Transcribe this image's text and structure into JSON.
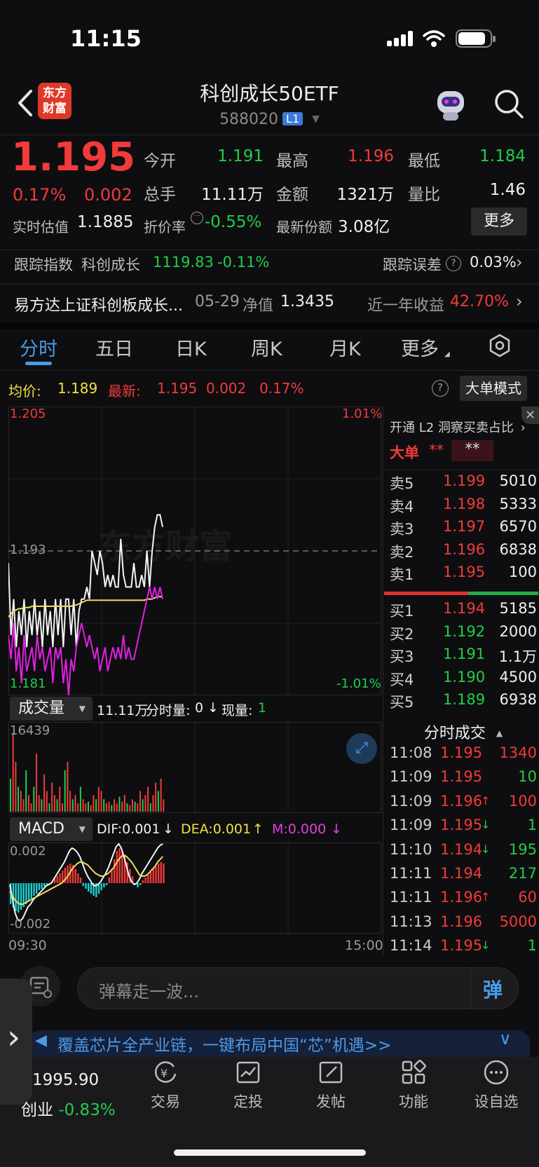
{
  "status": {
    "time": "11:15"
  },
  "header": {
    "logo": [
      "东方",
      "财富"
    ],
    "title": "科创成长50ETF",
    "code": "588020",
    "level": "L1"
  },
  "quote": {
    "price": "1.195",
    "change_pct": "0.17%",
    "change": "0.002",
    "open_label": "今开",
    "open": "1.191",
    "high_label": "最高",
    "high": "1.196",
    "low_label": "最低",
    "low": "1.184",
    "volume_label": "总手",
    "volume": "11.11万",
    "amount_label": "金额",
    "amount": "1321万",
    "ratio_label": "量比",
    "ratio": "1.46",
    "iopv_label": "实时估值",
    "iopv": "1.1885",
    "discount_label": "折价率",
    "discount": "-0.55%",
    "shares_label": "最新份额",
    "shares": "3.08亿",
    "more_button": "更多"
  },
  "tracking": {
    "index_label": "跟踪指数",
    "index_name": "科创成长",
    "index_value": "1119.83",
    "index_change": "-0.11%",
    "error_label": "跟踪误差",
    "error_value": "0.03%"
  },
  "fund": {
    "name": "易方达上证科创板成长...",
    "date": "05-29",
    "nav_label": "净值",
    "nav": "1.3435",
    "yield_label": "近一年收益",
    "yield": "42.70%"
  },
  "tabs": [
    "分时",
    "五日",
    "日K",
    "周K",
    "月K",
    "更多"
  ],
  "chart_info": {
    "avg_label": "均价:",
    "avg": "1.189",
    "latest_label": "最新:",
    "latest": "1.195",
    "change": "0.002",
    "pct": "0.17%",
    "big_order_button": "大单模式"
  },
  "chart_data": {
    "type": "line",
    "y_top": "1.205",
    "y_mid": "1.193",
    "y_bottom": "1.181",
    "pct_top": "1.01%",
    "pct_bottom": "-1.01%",
    "ylim": [
      1.181,
      1.205
    ],
    "ref": 1.193,
    "x_start": "09:30",
    "x_end": "15:00",
    "series": [
      {
        "values": [
          1.192,
          1.186,
          1.189,
          1.185,
          1.188,
          1.186,
          1.189,
          1.185,
          1.188,
          1.186,
          1.189,
          1.186,
          1.188,
          1.185,
          1.189,
          1.186,
          1.188,
          1.185,
          1.189,
          1.186,
          1.189,
          1.185,
          1.189,
          1.189,
          1.186,
          1.189,
          1.185,
          1.188,
          1.189,
          1.189,
          1.19,
          1.189,
          1.193,
          1.192,
          1.191,
          1.193,
          1.192,
          1.19,
          1.191,
          1.19,
          1.191,
          1.19,
          1.19,
          1.194,
          1.191,
          1.19,
          1.19,
          1.19,
          1.192,
          1.19,
          1.19,
          1.191,
          1.19,
          1.193,
          1.19,
          1.193,
          1.195,
          1.196,
          1.196,
          1.195
        ]
      },
      {
        "values": [
          1.1875,
          1.1878,
          1.188,
          1.1881,
          1.1882,
          1.1882,
          1.1883,
          1.1883,
          1.1883,
          1.1884,
          1.1884,
          1.1884,
          1.1884,
          1.1884,
          1.1884,
          1.1884,
          1.1884,
          1.1884,
          1.1884,
          1.1884,
          1.1884,
          1.1884,
          1.1884,
          1.1884,
          1.1884,
          1.1885,
          1.1885,
          1.1886,
          1.1887,
          1.1888,
          1.1889,
          1.1889,
          1.1889,
          1.1889,
          1.1889,
          1.1889,
          1.1889,
          1.1889,
          1.1889,
          1.1889,
          1.1889,
          1.1889,
          1.1889,
          1.1889,
          1.1889,
          1.1889,
          1.1889,
          1.1889,
          1.1889,
          1.1889,
          1.1889,
          1.1889,
          1.1889,
          1.189,
          1.189,
          1.189,
          1.1891,
          1.1892,
          1.1892,
          1.1892
        ]
      },
      {
        "values": [
          1.186,
          1.184,
          1.187,
          1.183,
          1.185,
          1.182,
          1.186,
          1.183,
          1.184,
          1.185,
          1.183,
          1.186,
          1.184,
          1.185,
          1.183,
          1.184,
          1.185,
          1.182,
          1.185,
          1.184,
          1.185,
          1.182,
          1.184,
          1.181,
          1.184,
          1.183,
          1.185,
          1.186,
          1.187,
          1.186,
          1.185,
          1.186,
          1.185,
          1.184,
          1.185,
          1.183,
          1.184,
          1.185,
          1.183,
          1.184,
          1.185,
          1.184,
          1.185,
          1.184,
          1.186,
          1.184,
          1.185,
          1.184,
          1.184,
          1.185,
          1.186,
          1.187,
          1.188,
          1.189,
          1.19,
          1.189,
          1.19,
          1.189,
          1.19,
          1.189
        ]
      }
    ]
  },
  "l2": {
    "promo": "开通 L2 洞察买卖占比",
    "big_label": "大单",
    "big_val_red": "**",
    "big_val_gray": "**"
  },
  "order_book": {
    "sells": [
      {
        "label": "卖5",
        "price": "1.199",
        "vol": "5010"
      },
      {
        "label": "卖4",
        "price": "1.198",
        "vol": "5333"
      },
      {
        "label": "卖3",
        "price": "1.197",
        "vol": "6570"
      },
      {
        "label": "卖2",
        "price": "1.196",
        "vol": "6838"
      },
      {
        "label": "卖1",
        "price": "1.195",
        "vol": "100"
      }
    ],
    "buys": [
      {
        "label": "买1",
        "price": "1.194",
        "vol": "5185"
      },
      {
        "label": "买2",
        "price": "1.192",
        "vol": "2000"
      },
      {
        "label": "买3",
        "price": "1.191",
        "vol": "1.1万"
      },
      {
        "label": "买4",
        "price": "1.190",
        "vol": "4500"
      },
      {
        "label": "买5",
        "price": "1.189",
        "vol": "6938"
      }
    ]
  },
  "trades_title": "分时成交",
  "trades": [
    {
      "time": "11:08",
      "price": "1.195",
      "arrow": "",
      "vol": "1340",
      "vc": "red"
    },
    {
      "time": "11:09",
      "price": "1.195",
      "arrow": "",
      "vol": "10",
      "vc": "green"
    },
    {
      "time": "11:09",
      "price": "1.196",
      "arrow": "↑",
      "vol": "100",
      "vc": "red"
    },
    {
      "time": "11:09",
      "price": "1.195",
      "arrow": "↓",
      "vol": "1",
      "vc": "green"
    },
    {
      "time": "11:10",
      "price": "1.194",
      "arrow": "↓",
      "vol": "195",
      "vc": "green"
    },
    {
      "time": "11:11",
      "price": "1.194",
      "arrow": "",
      "vol": "217",
      "vc": "green"
    },
    {
      "time": "11:11",
      "price": "1.196",
      "arrow": "↑",
      "vol": "60",
      "vc": "red"
    },
    {
      "time": "11:13",
      "price": "1.196",
      "arrow": "",
      "vol": "5000",
      "vc": "red"
    },
    {
      "time": "11:14",
      "price": "1.195",
      "arrow": "↓",
      "vol": "1",
      "vc": "green"
    }
  ],
  "volume_panel": {
    "label": "成交量",
    "total": "11.11万",
    "period_label": "分时量:",
    "period": "0",
    "current_label": "现量:",
    "current": "1",
    "max": "16439"
  },
  "macd_panel": {
    "label": "MACD",
    "dif": "DIF:0.001",
    "dea": "DEA:0.001",
    "m": "M:0.000",
    "top": "0.002",
    "bottom": "-0.002"
  },
  "comment": {
    "placeholder": "弹幕走一波...",
    "danmu": "弹"
  },
  "banner": {
    "text": "覆盖芯片全产业链，一键布局中国“芯”机遇>>"
  },
  "index_ticker": {
    "value": "1995.90",
    "name": "创业",
    "change": "-0.83%"
  },
  "nav": [
    "交易",
    "定投",
    "发帖",
    "功能",
    "设自选"
  ]
}
